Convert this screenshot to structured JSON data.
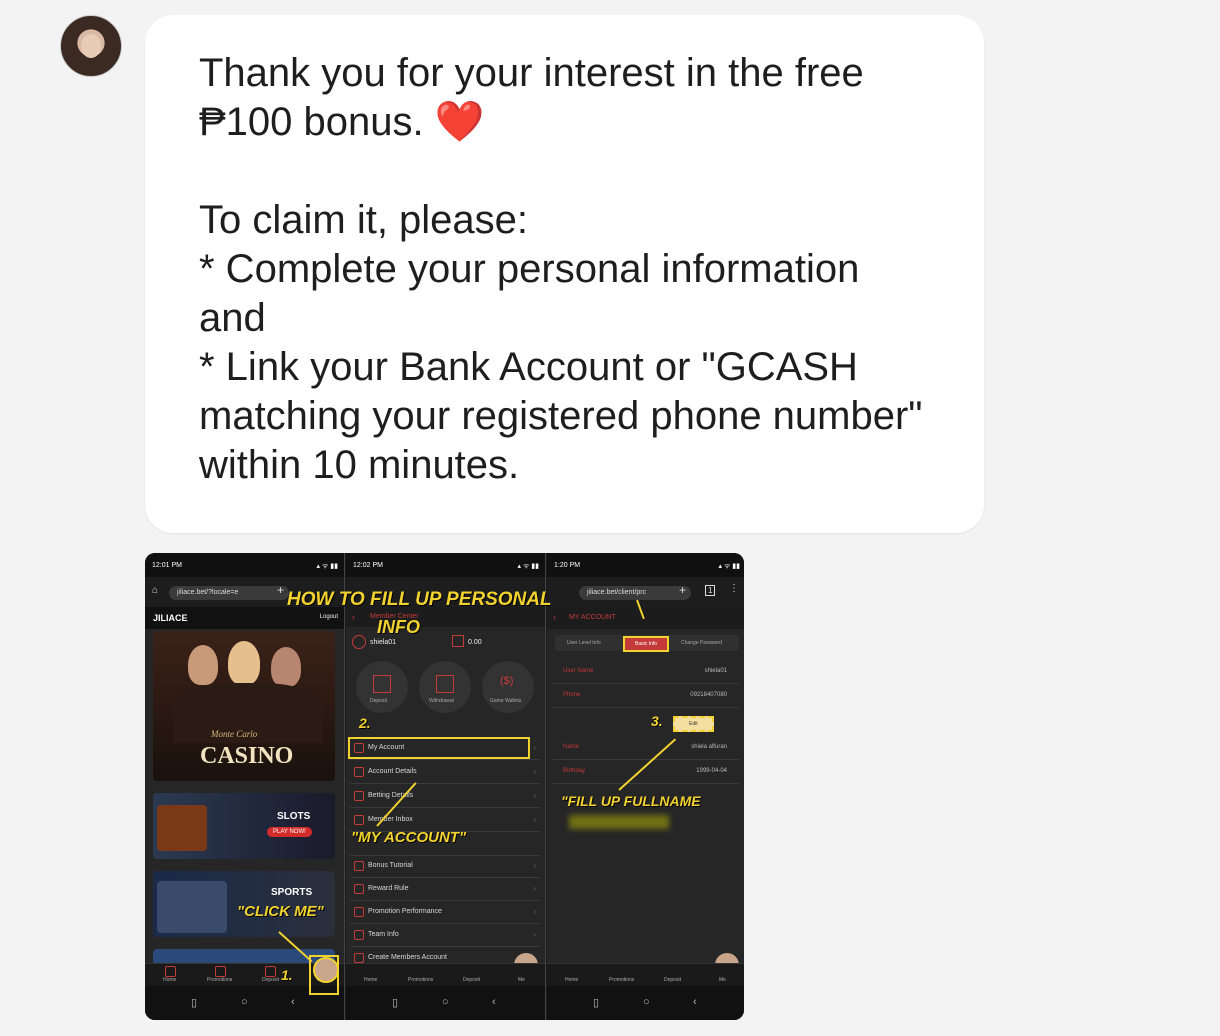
{
  "message": {
    "text": "Thank you for your interest in the free ₱100 bonus. ❤️\n\nTo claim it, please:\n* Complete your personal information and\n* Link your Bank Account or \"GCASH matching your registered phone number\" within 10 minutes.",
    "heart_color": "#e02828"
  },
  "screenshot": {
    "overlay_title_line1": "HOW TO FILL UP PERSONAL",
    "overlay_title_line2": "INFO",
    "step1": "1.",
    "step2": "2.",
    "step3": "3.",
    "click_me": "\"CLICK ME\"",
    "my_account_callout": "\"MY ACCOUNT\"",
    "fill_fullname": "\"FILL UP FULLNAME",
    "phone1": {
      "time": "12:01 PM",
      "url": "jiliace.bet/?locale=e",
      "logo": "JILIACE",
      "logout": "Logout",
      "casino_script": "Monte Carlo",
      "casino": "CASINO",
      "slots": "SLOTS",
      "play_now": "PLAY NOW!",
      "sports": "SPORTS",
      "tabs": [
        "Home",
        "Promotions",
        "Deposit",
        "Me"
      ]
    },
    "phone2": {
      "time": "12:02 PM",
      "header": "Member Center",
      "username": "shiela01",
      "balance": "0.00",
      "actions": [
        "Deposit",
        "Withdrawal",
        "Game Wallets"
      ],
      "menu": [
        "My Account",
        "Account Details",
        "Betting Details",
        "Member Inbox",
        "Bonus Tutorial",
        "Reward Rule",
        "Promotion Performance",
        "Team Info",
        "Create Members Account"
      ],
      "tabs": [
        "Home",
        "Promotions",
        "Deposit",
        "Me"
      ]
    },
    "phone3": {
      "time": "1:20 PM",
      "url": "jiliace.bet/client/prc",
      "header": "MY ACCOUNT",
      "tabs_top": [
        "User Level Info",
        "Basic Info",
        "Change Password"
      ],
      "user_name_label": "User Name",
      "user_name_value": "shiela01",
      "phone_label": "Phone",
      "phone_value": "09218407080",
      "edit": "Edit",
      "name_label": "Name",
      "name_value": "shiela alfuran",
      "birthday_label": "Birthday",
      "birthday_value": "1999-04-04",
      "tabs": [
        "Home",
        "Promotions",
        "Deposit",
        "Me"
      ]
    }
  }
}
